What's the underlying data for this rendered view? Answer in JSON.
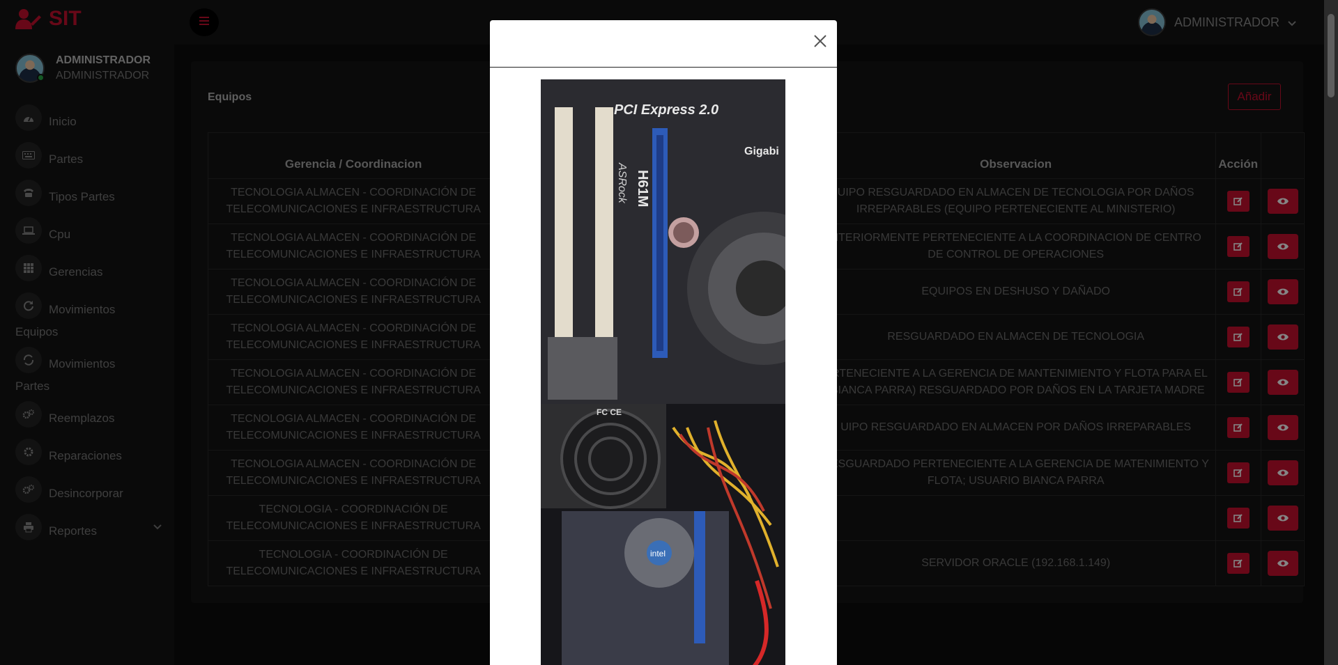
{
  "brand": {
    "name": "SIT",
    "icon": "user-cog-icon"
  },
  "header": {
    "user_name": "ADMINISTRADOR",
    "menu_icon": "hamburger-icon"
  },
  "sidebar": {
    "user_name": "ADMINISTRADOR",
    "user_role": "ADMINISTRADOR",
    "items": [
      {
        "label": "Inicio",
        "icon": "dashboard-icon"
      },
      {
        "label": "Partes",
        "icon": "keyboard-icon"
      },
      {
        "label": "Tipos Partes",
        "icon": "phone-icon"
      },
      {
        "label": "Cpu",
        "icon": "laptop-icon"
      },
      {
        "label": "Gerencias",
        "icon": "grid-icon"
      },
      {
        "label": "Movimientos Equipos",
        "icon": "refresh-icon"
      },
      {
        "label": "Movimientos Partes",
        "icon": "sync-icon"
      },
      {
        "label": "Reemplazos",
        "icon": "cogs-icon"
      },
      {
        "label": "Reparaciones",
        "icon": "cog-icon"
      },
      {
        "label": "Desincorporar",
        "icon": "cogs-icon"
      },
      {
        "label": "Reportes",
        "icon": "printer-icon"
      }
    ]
  },
  "card": {
    "title": "Equipos",
    "add_label": "Añadir"
  },
  "table": {
    "headers": {
      "gerencia": "Gerencia / Coordinacion",
      "observacion": "Observacion",
      "accion": "Acción"
    },
    "rows": [
      {
        "gerencia": "TECNOLOGIA ALMACEN - COORDINACIÓN DE TELECOMUNICACIONES E INFRAESTRUCTURA",
        "observacion": "UIPO RESGUARDADO EN ALMACEN DE TECNOLOGIA POR DAÑOS IRREPARABLES (EQUIPO PERTENECIENTE AL MINISTERIO)"
      },
      {
        "gerencia": "TECNOLOGIA ALMACEN - COORDINACIÓN DE TELECOMUNICACIONES E INFRAESTRUCTURA",
        "observacion": "NTERIORMENTE PERTENECIENTE A LA COORDINACION DE CENTRO DE CONTROL DE OPERACIONES"
      },
      {
        "gerencia": "TECNOLOGIA ALMACEN - COORDINACIÓN DE TELECOMUNICACIONES E INFRAESTRUCTURA",
        "observacion": "EQUIPOS EN DESHUSO Y DAÑADO"
      },
      {
        "gerencia": "TECNOLOGIA ALMACEN - COORDINACIÓN DE TELECOMUNICACIONES E INFRAESTRUCTURA",
        "observacion": "RESGUARDADO EN ALMACEN DE TECNOLOGIA"
      },
      {
        "gerencia": "TECNOLOGIA ALMACEN - COORDINACIÓN DE TELECOMUNICACIONES E INFRAESTRUCTURA",
        "observacion": "ERTENECIENTE A LA GERENCIA DE MANTENIMIENTO Y FLOTA PARA EL (BIANCA PARRA) RESGUARDADO POR DAÑOS EN LA TARJETA MADRE"
      },
      {
        "gerencia": "TECNOLOGIA ALMACEN - COORDINACIÓN DE TELECOMUNICACIONES E INFRAESTRUCTURA",
        "observacion": "UIPO RESGUARDADO EN ALMACEN POR DAÑOS IRREPARABLES"
      },
      {
        "gerencia": "TECNOLOGIA ALMACEN - COORDINACIÓN DE TELECOMUNICACIONES E INFRAESTRUCTURA",
        "observacion": "RESGUARDADO PERTENECIENTE A LA GERENCIA DE MATENIMIENTO Y FLOTA; USUARIO BIANCA PARRA"
      },
      {
        "gerencia": "TECNOLOGIA - COORDINACIÓN DE TELECOMUNICACIONES E INFRAESTRUCTURA",
        "observacion": ""
      },
      {
        "gerencia": "TECNOLOGIA - COORDINACIÓN DE TELECOMUNICACIONES E INFRAESTRUCTURA",
        "observacion": "SERVIDOR ORACLE (192.168.1.149)"
      }
    ]
  },
  "modal": {
    "close_icon": "close-icon",
    "image_labels": {
      "slot_label": "PCI Express 2.0",
      "board_label": "H61M",
      "vendor": "ASRock",
      "brand_top": "Gigabi",
      "psu_mark": "FC CE",
      "cpu_brand": "intel"
    }
  },
  "colors": {
    "accent": "#c8102e",
    "background": "#0c0c0c",
    "panel": "#141414"
  }
}
